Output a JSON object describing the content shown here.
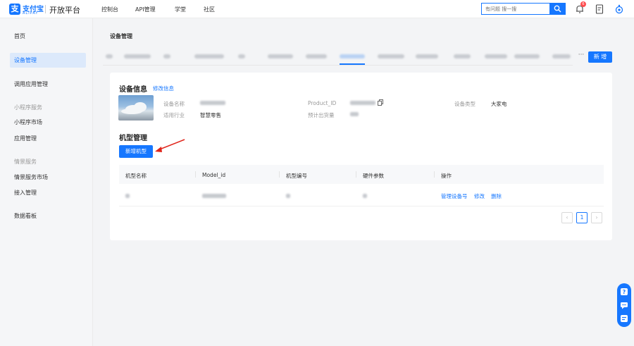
{
  "brand": {
    "logo_char": "支",
    "name_cn": "支付宝",
    "name_en": "ALIPAY",
    "platform": "开放平台"
  },
  "topnav": [
    "控制台",
    "API管理",
    "学堂",
    "社区"
  ],
  "search": {
    "placeholder": "有问题 搜一搜"
  },
  "notifications": {
    "count": "6"
  },
  "sidebar": {
    "items": {
      "home": "首页",
      "device_mgmt": "设备管理",
      "app_call_mgmt": "调用应用管理",
      "mini_group": "小程序服务",
      "mini_market": "小程序市场",
      "app_mgmt": "应用管理",
      "scene_group": "情景服务",
      "scene_market": "情景服务市场",
      "access_mgmt": "接入管理",
      "dashboard": "数据看板"
    }
  },
  "page_title": "设备管理",
  "tabs": {
    "more": "···",
    "add_button": "新 增"
  },
  "device_info": {
    "title": "设备信息",
    "edit_link": "修改信息",
    "labels": {
      "name": "设备名称",
      "industry": "适用行业",
      "product_id": "Product_ID",
      "expected_volume": "预计出货量",
      "device_type": "设备类型"
    },
    "values": {
      "industry": "智慧零售",
      "device_type": "大家电"
    }
  },
  "model_mgmt": {
    "title": "机型管理",
    "add_button": "新增机型",
    "columns": [
      "机型名称",
      "Model_id",
      "机型编号",
      "硬件参数",
      "操作"
    ],
    "row_actions": [
      "管理设备号",
      "修改",
      "删除"
    ]
  },
  "pagination": {
    "prev": "‹",
    "current": "1",
    "next": "›"
  },
  "colors": {
    "primary": "#1677ff",
    "arrow": "#e0251b",
    "badge": "#ff4d4f"
  },
  "icons": [
    "search-icon",
    "bell-icon",
    "document-icon",
    "gear-icon",
    "copy-icon",
    "help-icon",
    "chat-icon",
    "feedback-icon"
  ]
}
